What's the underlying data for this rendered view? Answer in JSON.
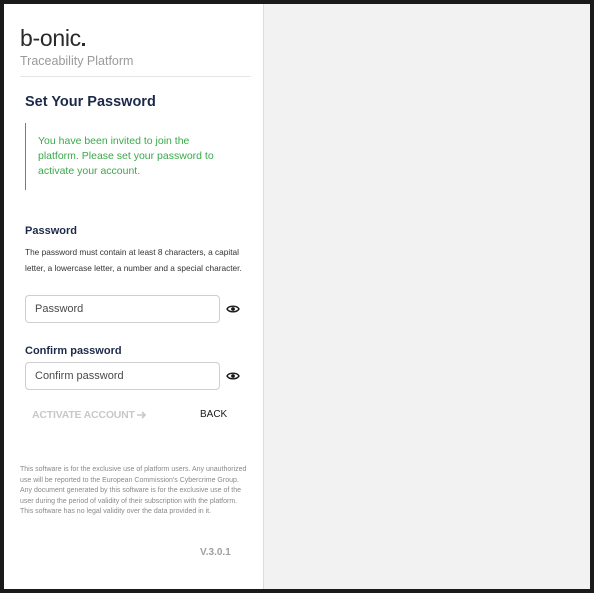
{
  "brand": {
    "logo_text": "b-onic",
    "subtitle": "Traceability Platform"
  },
  "page": {
    "title": "Set Your Password"
  },
  "alert": {
    "message": "You have been invited to join the platform. Please set your password to activate your account.",
    "color": "#3aa84a"
  },
  "password_field": {
    "label": "Password",
    "help_text": "The password must contain at least 8 characters, a capital letter, a lowercase letter, a number and a special character.",
    "placeholder": "Password",
    "value": "",
    "toggle_icon": "eye-icon"
  },
  "confirm_field": {
    "label": "Confirm password",
    "placeholder": "Confirm password",
    "value": "",
    "toggle_icon": "eye-icon"
  },
  "actions": {
    "activate_label": "ACTIVATE ACCOUNT",
    "activate_icon": "arrow-right-icon",
    "back_label": "BACK"
  },
  "footer": {
    "disclaimer": "This software is for the exclusive use of platform users. Any unauthorized use will be reported to the European Commission's Cybercrime Group. Any document generated by this software is for the exclusive use of the user during the period of validity of their subscription with the platform. This software has no legal validity over the data provided in it.",
    "version": "V.3.0.1"
  }
}
